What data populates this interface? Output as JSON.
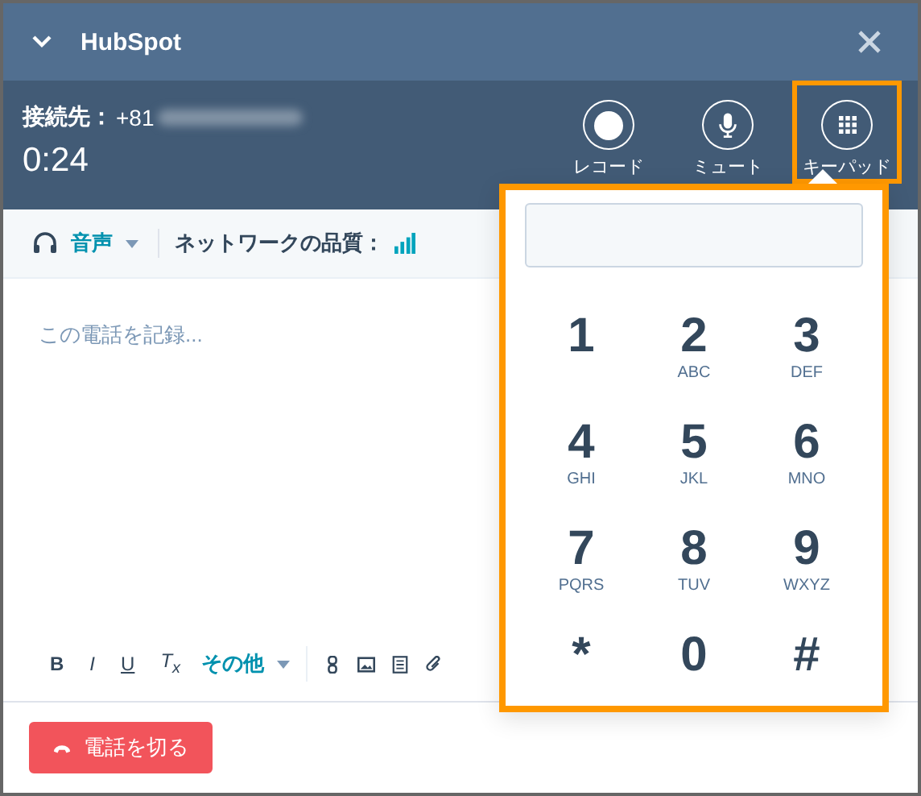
{
  "window": {
    "title": "HubSpot"
  },
  "call": {
    "label": "接続先：",
    "number": "+81",
    "timer": "0:24"
  },
  "call_controls": [
    {
      "kind": "record",
      "label": "レコード",
      "selected": false
    },
    {
      "kind": "mute",
      "label": "ミュート",
      "selected": false
    },
    {
      "kind": "keypad",
      "label": "キーパッド",
      "selected": true
    }
  ],
  "audio": {
    "label": "音声",
    "network_label": "ネットワークの品質："
  },
  "notes": {
    "placeholder": "この電話を記録..."
  },
  "format_buttons": [
    {
      "kind": "bold",
      "label": "B"
    },
    {
      "kind": "italic",
      "label": "I"
    },
    {
      "kind": "underline",
      "label": "U"
    },
    {
      "kind": "clear",
      "label": "T$_{x}$"
    }
  ],
  "more_menu": "その他",
  "insert_tools": [
    {
      "kind": "link"
    },
    {
      "kind": "image"
    },
    {
      "kind": "document"
    },
    {
      "kind": "attachment"
    }
  ],
  "hangup_button": "電話を切る",
  "keypad": {
    "keys": [
      {
        "digit": "1"
      },
      {
        "digit": "2",
        "letters": "ABC"
      },
      {
        "digit": "3",
        "letters": "DEF"
      },
      {
        "digit": "4",
        "letters": "GHI"
      },
      {
        "digit": "5",
        "letters": "JKL"
      },
      {
        "digit": "6",
        "letters": "MNO"
      },
      {
        "digit": "7",
        "letters": "PQRS"
      },
      {
        "digit": "8",
        "letters": "TUV"
      },
      {
        "digit": "9",
        "letters": "WXYZ"
      },
      {
        "digit": "*"
      },
      {
        "digit": "0"
      },
      {
        "digit": "#"
      }
    ]
  }
}
